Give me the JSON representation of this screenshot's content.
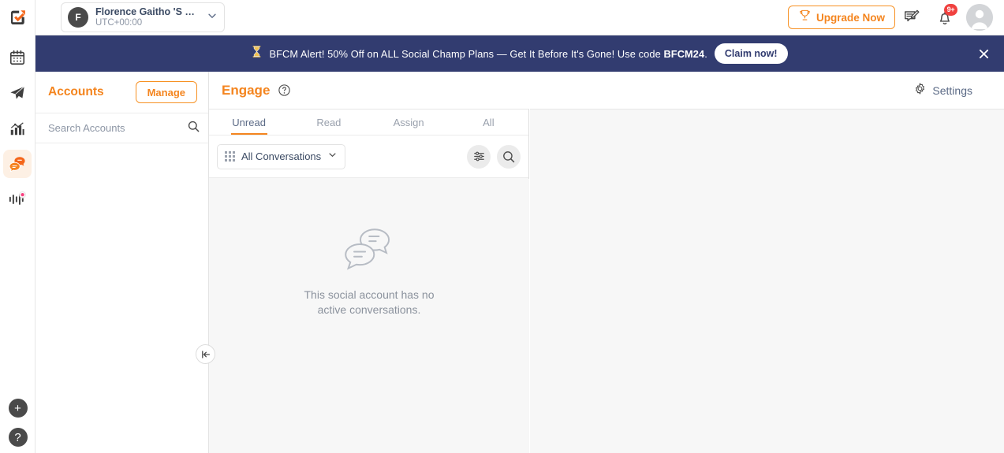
{
  "app": {
    "logo_icon": "social-champ-check-logo"
  },
  "rail": {
    "items": [
      {
        "id": "calendar",
        "icon": "calendar-icon",
        "active": false
      },
      {
        "id": "publish",
        "icon": "paper-plane-icon",
        "active": false
      },
      {
        "id": "analytics",
        "icon": "bar-chart-icon",
        "active": false
      },
      {
        "id": "engage",
        "icon": "chat-bubbles-icon",
        "active": true
      },
      {
        "id": "listening",
        "icon": "audio-waveform-icon",
        "active": false,
        "badge_dot": true
      }
    ],
    "bottom": [
      {
        "id": "add",
        "icon": "plus-circle-icon",
        "label": "+"
      },
      {
        "id": "help",
        "icon": "question-circle-icon",
        "label": "?"
      }
    ]
  },
  "topbar": {
    "workspace": {
      "avatar_initial": "F",
      "name": "Florence Gaitho 'S …",
      "timezone": "UTC+00:00",
      "chevron_icon": "chevron-down-icon"
    },
    "upgrade": {
      "label": "Upgrade Now",
      "icon": "trophy-icon",
      "color": "#f4851f"
    },
    "feedback_icon": "compose-message-icon",
    "notifications": {
      "icon": "bell-icon",
      "badge": "9+",
      "badge_color": "#f0413f"
    },
    "avatar_icon": "user-avatar-icon"
  },
  "banner": {
    "icon": "hourglass-icon",
    "text_before": "BFCM Alert! 50% Off on ALL Social Champ Plans — Get It Before It's Gone! Use code ",
    "promo_code": "BFCM24",
    "text_after": ".",
    "cta_label": "Claim now!",
    "close_icon": "close-icon",
    "background": "#323c70"
  },
  "accounts": {
    "title": "Accounts",
    "manage_label": "Manage",
    "search_placeholder": "Search Accounts",
    "search_value": "",
    "search_icon": "search-icon",
    "collapse_icon": "collapse-panel-icon"
  },
  "engage": {
    "title": "Engage",
    "help_icon": "help-circle-icon",
    "settings_label": "Settings",
    "settings_icon": "gear-icon",
    "tabs": [
      {
        "label": "Unread",
        "active": true
      },
      {
        "label": "Read",
        "active": false
      },
      {
        "label": "Assign",
        "active": false
      },
      {
        "label": "All",
        "active": false
      }
    ],
    "filter": {
      "grid_icon": "grid-icon",
      "selected": "All Conversations",
      "chevron_icon": "chevron-down-icon",
      "settings_icon": "filter-sliders-icon",
      "search_icon": "search-icon"
    },
    "empty_state": {
      "icon": "chat-bubbles-empty-icon",
      "line1": "This social account has no",
      "line2": "active conversations."
    }
  }
}
